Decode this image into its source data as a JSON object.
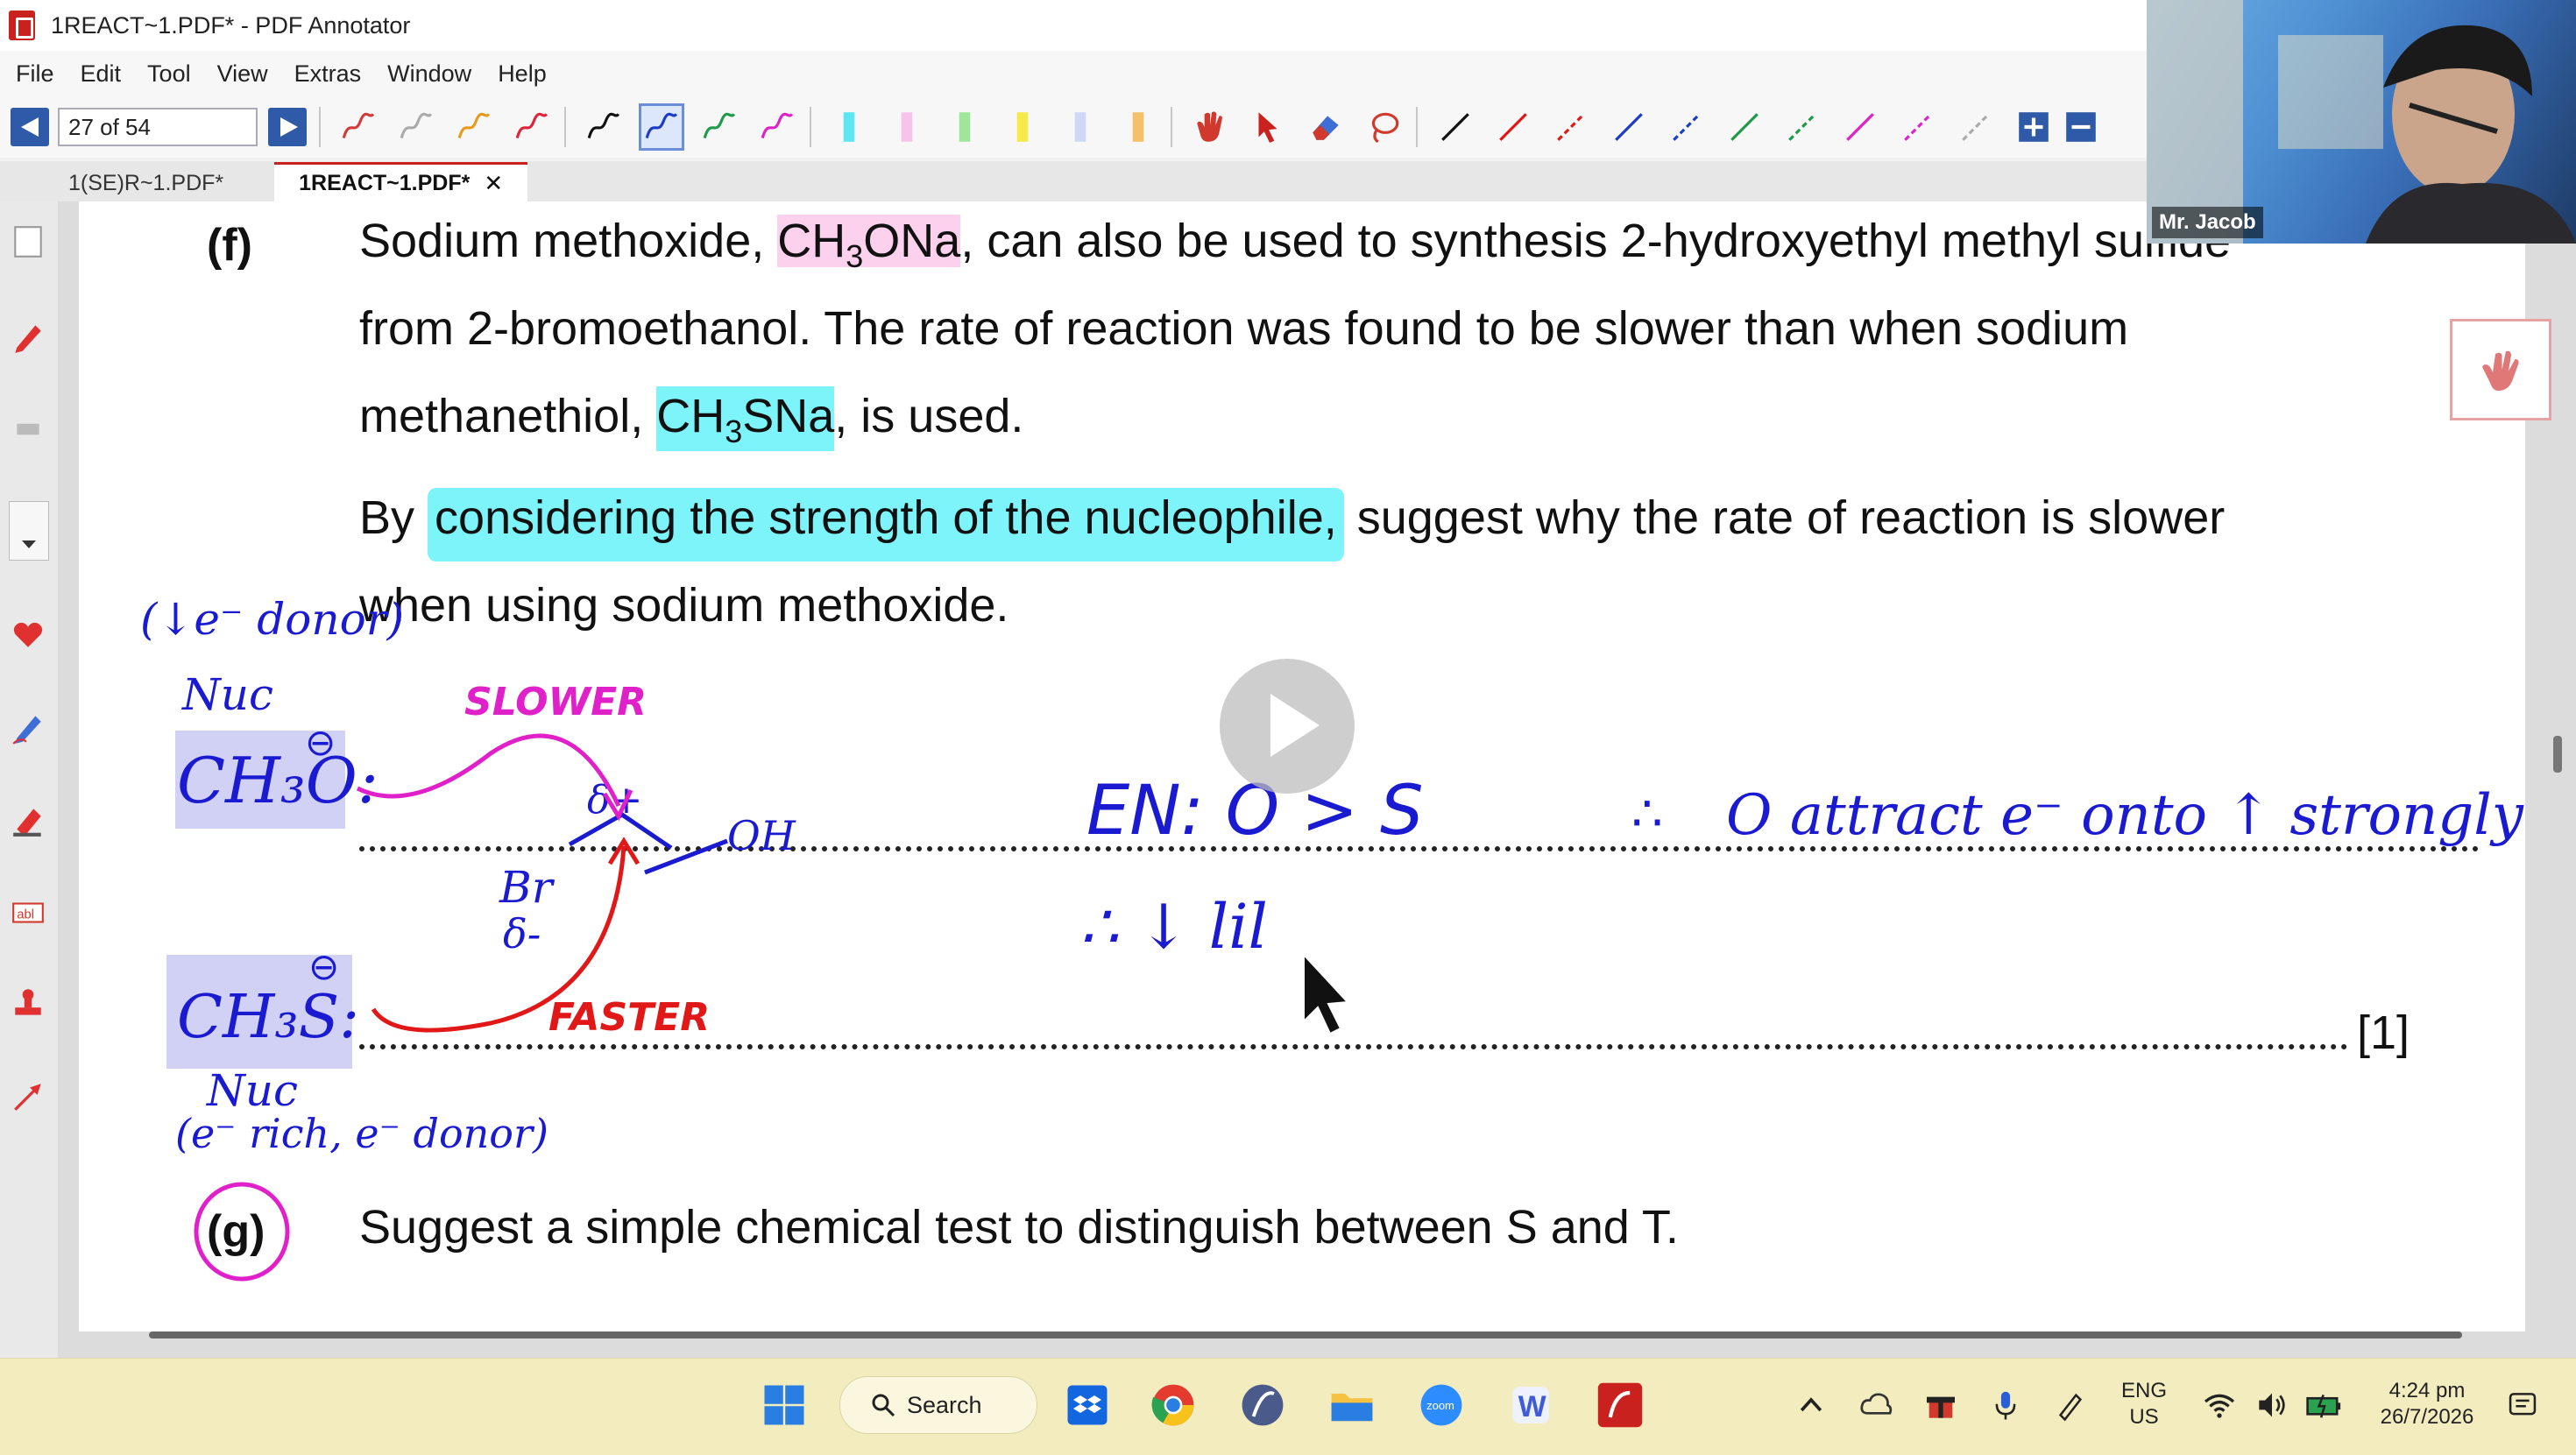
{
  "window": {
    "title": "1REACT~1.PDF* - PDF Annotator"
  },
  "menu": [
    "File",
    "Edit",
    "Tool",
    "View",
    "Extras",
    "Window",
    "Help"
  ],
  "toolbar": {
    "page_indicator": "27 of 54"
  },
  "tabs": [
    {
      "label": "1(SE)R~1.PDF*"
    },
    {
      "label": "1REACT~1.PDF*",
      "close": "✕"
    }
  ],
  "webcam": {
    "name": "Mr. Jacob"
  },
  "document": {
    "f_label": "(f)",
    "f_line1_a": "Sodium methoxide, ",
    "f_line1_formula_a": "CH",
    "f_line1_formula_sub": "3",
    "f_line1_formula_b": "ONa",
    "f_line1_b": ", can also be used to synthesis 2-hydroxyethyl methyl sulfide",
    "f_line2": "from 2-bromoethanol. The rate of reaction was found to be slower than when sodium",
    "f_line3_a": "methanethiol, ",
    "f_line3_formula_a": "CH",
    "f_line3_formula_sub": "3",
    "f_line3_formula_b": "SNa",
    "f_line3_b": ", is used.",
    "f_line4_a": "By ",
    "f_line4_highlight": "considering the strength of the nucleophile,",
    "f_line4_b": " suggest why the rate of reaction is slower",
    "f_line5": "when using sodium methoxide.",
    "mark": "[1]",
    "g_label": "(g)",
    "g_text": "Suggest a simple chemical test to distinguish between S and T."
  },
  "handwriting": {
    "top_note": "(↓e⁻ donor)",
    "nuc_top": "Nuc",
    "ch3o": "CH₃O:",
    "minus": "⊖",
    "slower": "SLOWER",
    "delta_plus": "δ+",
    "oh": "OH",
    "br": "Br",
    "delta_minus": "δ-",
    "ch3s": "CH₃S:",
    "faster": "FASTER",
    "nuc_bottom": "Nuc",
    "bottom_note": "(e⁻ rich, e⁻ donor)",
    "en_line": "EN: O > S",
    "therefore": "∴",
    "o_attract": "O attract e⁻ onto ↑ strongly",
    "line2": "∴ ↓ lil"
  },
  "taskbar": {
    "search_label": "Search",
    "lang_top": "ENG",
    "lang_bottom": "US",
    "time": "4:24 pm",
    "date": "26/7/2026"
  },
  "colors": {
    "ink_blue": "#1a1ad0",
    "ink_magenta": "#e020c8",
    "ink_red": "#e01818",
    "highlight_cyan": "#7cf4f9",
    "highlight_pink": "#fbd1ee",
    "highlight_lavender": "#c9c9f5"
  }
}
